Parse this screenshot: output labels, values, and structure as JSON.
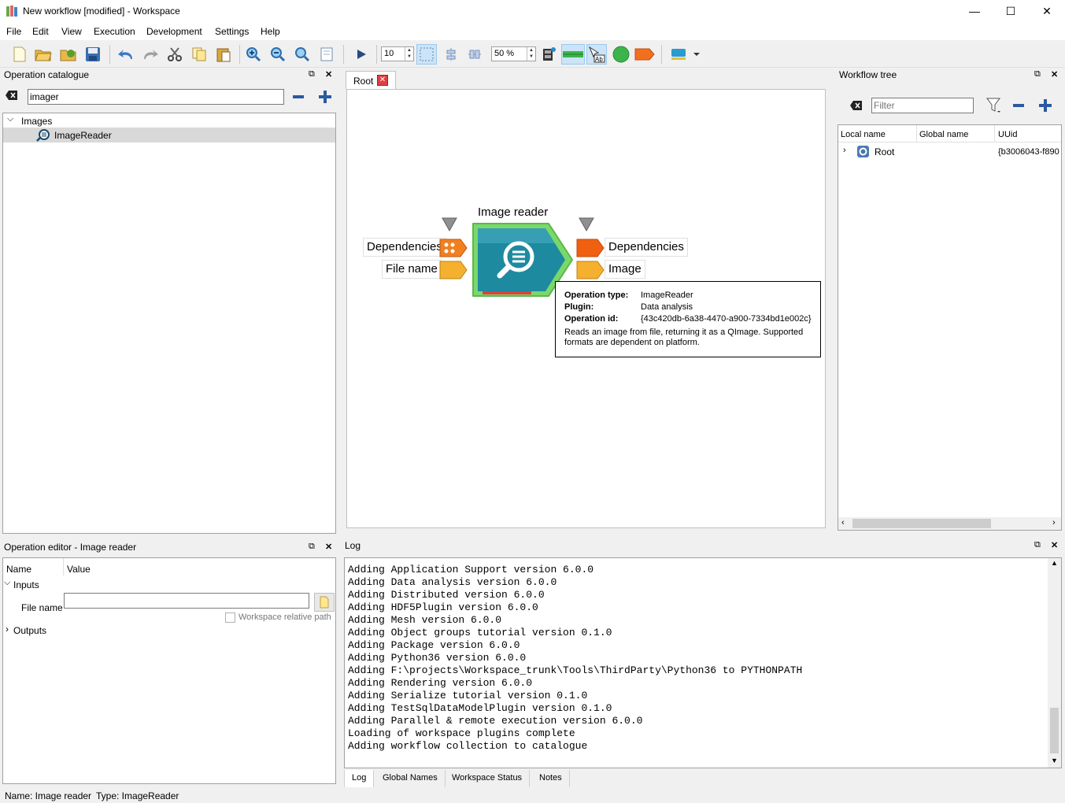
{
  "window": {
    "title": "New workflow [modified] - Workspace",
    "minimize": "—",
    "maximize": "☐",
    "close": "✕"
  },
  "menu": [
    "File",
    "Edit",
    "View",
    "Execution",
    "Development",
    "Settings",
    "Help"
  ],
  "toolbar": {
    "step_value": "10",
    "zoom_value": "50 %"
  },
  "catalogue": {
    "title": "Operation catalogue",
    "search_value": "imager",
    "group": "Images",
    "item": "ImageReader"
  },
  "canvas": {
    "tab_label": "Root",
    "node_title": "Image reader",
    "inputs": [
      "Dependencies",
      "File name"
    ],
    "outputs": [
      "Dependencies",
      "Image"
    ],
    "tooltip": {
      "op_type_key": "Operation type:",
      "op_type_val": "ImageReader",
      "plugin_key": "Plugin:",
      "plugin_val": "Data analysis",
      "op_id_key": "Operation id:",
      "op_id_val": "{43c420db-6a38-4470-a900-7334bd1e002c}",
      "desc_line1": "Reads an image from file, returning it as a QImage. Supported",
      "desc_line2": "formats are dependent on platform."
    }
  },
  "workflow_tree": {
    "title": "Workflow tree",
    "filter_placeholder": "Filter",
    "columns": [
      "Local name",
      "Global name",
      "UUid"
    ],
    "row": {
      "local": "Root",
      "global": "",
      "uuid": "{b3006043-f890"
    }
  },
  "editor": {
    "title": "Operation editor - Image reader",
    "col_name": "Name",
    "col_value": "Value",
    "inputs_label": "Inputs",
    "file_name_label": "File name",
    "file_name_value": "",
    "relative_label": "Workspace relative path",
    "outputs_label": "Outputs"
  },
  "log": {
    "title": "Log",
    "lines": [
      "Adding Application Support version 6.0.0",
      "Adding Data analysis version 6.0.0",
      "Adding Distributed version 6.0.0",
      "Adding HDF5Plugin version 6.0.0",
      "Adding Mesh version 6.0.0",
      "Adding Object groups tutorial version 0.1.0",
      "Adding Package version 6.0.0",
      "Adding Python36 version 6.0.0",
      "Adding F:\\projects\\Workspace_trunk\\Tools\\ThirdParty\\Python36 to PYTHONPATH",
      "Adding Rendering version 6.0.0",
      "Adding Serialize tutorial version 0.1.0",
      "Adding TestSqlDataModelPlugin version 0.1.0",
      "Adding Parallel & remote execution version 6.0.0",
      "Loading of workspace plugins complete",
      "Adding workflow collection to catalogue"
    ],
    "tabs": [
      "Log",
      "Global Names",
      "Workspace Status",
      "Notes"
    ]
  },
  "status": {
    "name": "Name: Image reader",
    "type": "Type: ImageReader"
  }
}
